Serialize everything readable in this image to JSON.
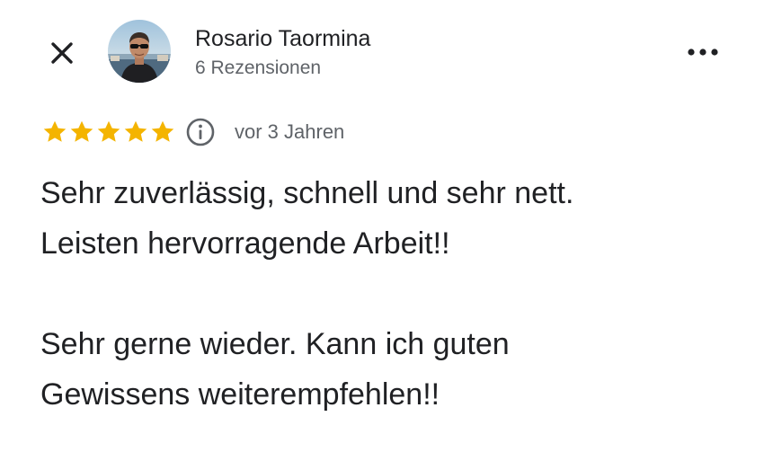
{
  "header": {
    "close_icon": "close-icon",
    "more_icon": "more-horizontal-icon"
  },
  "author": {
    "name": "Rosario Taormina",
    "review_count_text": "6 Rezensionen"
  },
  "rating": {
    "stars": 5,
    "max_stars": 5,
    "star_color": "#f4b400",
    "info_icon": "info-icon",
    "date_text": "vor 3 Jahren"
  },
  "review": {
    "paragraph_1": "Sehr zuverlässig, schnell und sehr nett.\nLeisten hervorragende Arbeit!!",
    "paragraph_2": "Sehr gerne wieder. Kann ich guten\nGewissens weiterempfehlen!!"
  }
}
